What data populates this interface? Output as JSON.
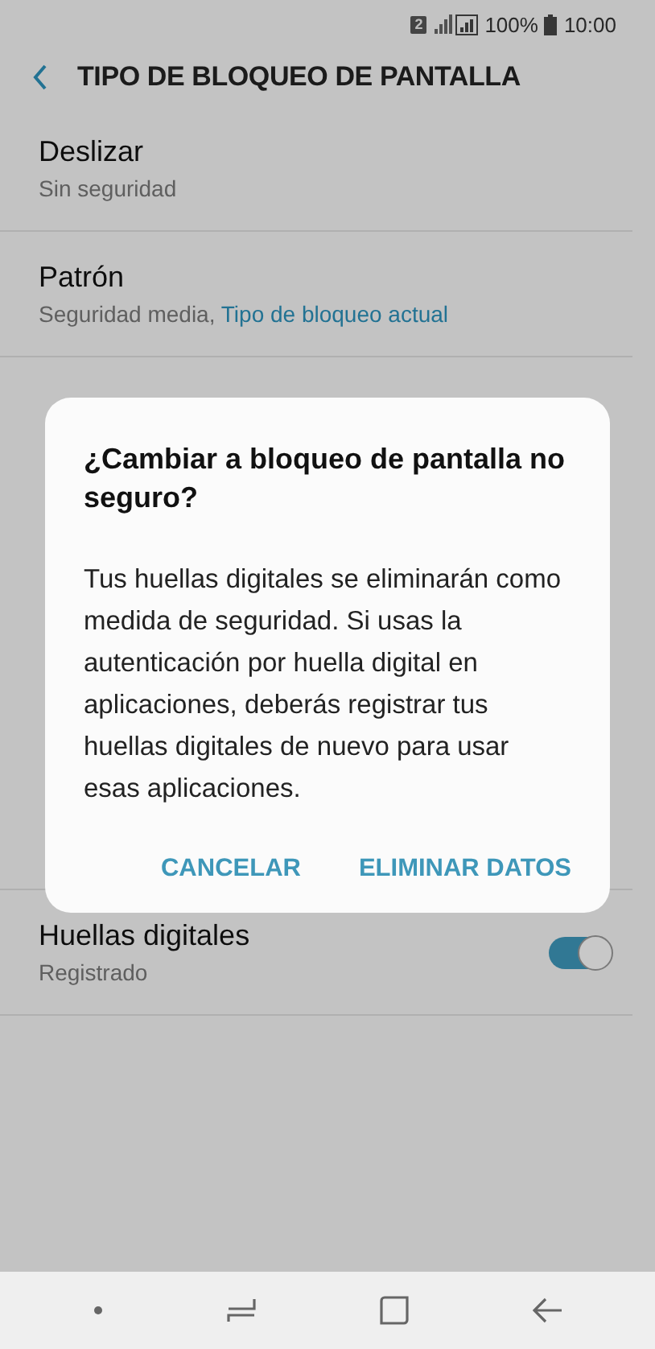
{
  "status_bar": {
    "sim_badge": "2",
    "battery_text": "100%",
    "time": "10:00"
  },
  "header": {
    "title": "TIPO DE BLOQUEO DE PANTALLA"
  },
  "rows": [
    {
      "kind": "item",
      "title": "Deslizar",
      "subtitle": "Sin seguridad"
    },
    {
      "kind": "item",
      "title": "Patrón",
      "subtitle": "Seguridad media,",
      "current": "Tipo de bloqueo actual"
    },
    {
      "kind": "hidden"
    },
    {
      "kind": "toggle",
      "title": "Huellas digitales",
      "subtitle": "Registrado",
      "on": true
    }
  ],
  "dialog": {
    "title": "¿Cambiar a bloqueo de pantalla no seguro?",
    "message": "Tus huellas digitales se eliminarán como medida de seguridad. Si usas la autenticación por huella digital en aplicaciones, deberás registrar tus huellas digitales de nuevo para usar esas aplicaciones.",
    "buttons": [
      "CANCELAR",
      "ELIMINAR DATOS"
    ]
  }
}
